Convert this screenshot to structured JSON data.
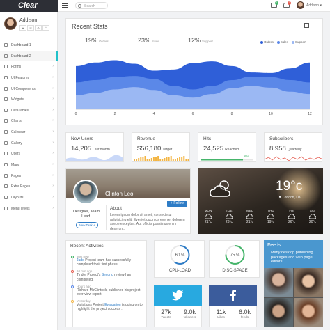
{
  "topbar": {
    "brand": "Clear",
    "search_placeholder": "Search",
    "mail_badge": "1",
    "notif_badge": "2",
    "user_name": "Addison"
  },
  "sidebar": {
    "user_name": "Addison",
    "menu": [
      {
        "label": "Dashboard 1",
        "active": false,
        "has_caret": false
      },
      {
        "label": "Dashboard 2",
        "active": true,
        "has_caret": false
      },
      {
        "label": "Forms",
        "active": false,
        "has_caret": true
      },
      {
        "label": "UI Features",
        "active": false,
        "has_caret": true
      },
      {
        "label": "UI Components",
        "active": false,
        "has_caret": true
      },
      {
        "label": "Widgets",
        "active": false,
        "has_caret": true
      },
      {
        "label": "DataTables",
        "active": false,
        "has_caret": true
      },
      {
        "label": "Charts",
        "active": false,
        "has_caret": true
      },
      {
        "label": "Calendar",
        "active": false,
        "has_caret": true
      },
      {
        "label": "Gallery",
        "active": false,
        "has_caret": true
      },
      {
        "label": "Users",
        "active": false,
        "has_caret": true
      },
      {
        "label": "Maps",
        "active": false,
        "has_caret": true
      },
      {
        "label": "Pages",
        "active": false,
        "has_caret": true
      },
      {
        "label": "Extra Pages",
        "active": false,
        "has_caret": true
      },
      {
        "label": "Layouts",
        "active": false,
        "has_caret": true
      },
      {
        "label": "Menu levels",
        "active": false,
        "has_caret": true
      }
    ]
  },
  "recent_stats": {
    "title": "Recent Stats",
    "kpis": [
      {
        "value": "19%",
        "label": "Orders"
      },
      {
        "value": "23%",
        "label": "Sales"
      },
      {
        "value": "12%",
        "label": "Support"
      }
    ],
    "legend": [
      {
        "label": "Orders",
        "color": "#2f5fd8"
      },
      {
        "label": "Sales",
        "color": "#5b88e8"
      },
      {
        "label": "Support",
        "color": "#9bb8f3"
      }
    ]
  },
  "chart_data": {
    "type": "area",
    "x": [
      0,
      1,
      2,
      3,
      4,
      5,
      6,
      7,
      8,
      9,
      10,
      11,
      12
    ],
    "xticks": [
      "0",
      "2",
      "4",
      "6",
      "8",
      "10",
      "12"
    ],
    "xlim": [
      0,
      12
    ],
    "ylim": [
      0,
      100
    ],
    "series": [
      {
        "name": "Orders",
        "color": "#2f5fd8",
        "values": [
          74,
          80,
          84,
          78,
          66,
          68,
          79,
          82,
          74,
          63,
          62,
          70,
          80
        ]
      },
      {
        "name": "Sales",
        "color": "#5b88e8",
        "values": [
          46,
          50,
          55,
          57,
          52,
          40,
          34,
          40,
          50,
          56,
          55,
          50,
          46
        ]
      },
      {
        "name": "Support",
        "color": "#9bb8f3",
        "values": [
          24,
          28,
          34,
          38,
          33,
          24,
          20,
          26,
          36,
          40,
          37,
          30,
          26
        ]
      }
    ],
    "grid": false
  },
  "small_cards": [
    {
      "title": "New Users",
      "value": "14,205",
      "sub": "Last month",
      "color": "#5b88e8",
      "kind": "area"
    },
    {
      "title": "Revenue",
      "value": "$56,180",
      "sub": "Target",
      "color": "#f3b543",
      "kind": "bars"
    },
    {
      "title": "Hits",
      "value": "24,525",
      "sub": "Reached",
      "color": "#46b56b",
      "kind": "progress",
      "progress_label": "6%"
    },
    {
      "title": "Subscribers",
      "value": "8,958",
      "sub": "Quarterly",
      "color": "#e4594d",
      "kind": "line"
    }
  ],
  "profile": {
    "name": "Clinton Leo",
    "role": "Designer, Team Lead.",
    "task_button": "New Task +",
    "follow_button": "+ Follow",
    "about_title": "About",
    "about_text": "Lorem ipsum dolor sit amet, consectetur adipisicing elit. Eveniet ducimus eveniet dolorem saepe excepturi. Aut officiis possimus enim deserunt."
  },
  "weather": {
    "temperature": "19°c",
    "location": "London, UK",
    "days": [
      {
        "day": "MON",
        "temp": "21°c",
        "icon": "cloud-sun-icon"
      },
      {
        "day": "TUE",
        "temp": "26°c",
        "icon": "cloud-icon"
      },
      {
        "day": "WED",
        "temp": "21°c",
        "icon": "cloud-icon"
      },
      {
        "day": "THU",
        "temp": "19°c",
        "icon": "cloud-icon"
      },
      {
        "day": "FRI",
        "temp": "26°c",
        "icon": "cloud-icon"
      },
      {
        "day": "SAT",
        "temp": "20°c",
        "icon": "cloud-icon"
      }
    ]
  },
  "activities": {
    "title": "Recent Activities",
    "items": [
      {
        "time": "Just now",
        "pre": "",
        "link": "Jade",
        "post": " Project team has successfully completed their first phase.",
        "color": "#46b56b"
      },
      {
        "time": "10 min ago",
        "pre": "Tinder Project's ",
        "link": "Second",
        "post": " review has completed.",
        "color": "#e4594d"
      },
      {
        "time": "Hours ago",
        "pre": "Richard McClintock, published his project over view report.",
        "link": "",
        "post": "",
        "color": "#5b88e8"
      },
      {
        "time": "Yesterday",
        "pre": "Variations Project ",
        "link": "Evaluation",
        "post": " is going on to highlight the project success .",
        "color": "#f3b543"
      }
    ]
  },
  "gauges": [
    {
      "value": 60,
      "label_value": "60 %",
      "label": "CPU-LOAD",
      "color": "#2e7cc6"
    },
    {
      "value": 75,
      "label_value": "75 %",
      "label": "DISC-SPACE",
      "color": "#46b56b"
    }
  ],
  "social": [
    {
      "network": "twitter-icon",
      "color": "#28a9e0",
      "stats": [
        {
          "num": "27k",
          "label": "Tweets"
        },
        {
          "num": "9.0k",
          "label": "followers"
        }
      ]
    },
    {
      "network": "facebook-icon",
      "color": "#3b5c9c",
      "stats": [
        {
          "num": "11k",
          "label": "Likes"
        },
        {
          "num": "6.0k",
          "label": "feeds"
        }
      ]
    }
  ],
  "feeds": {
    "title": "Feeds",
    "text": "Many desktop publishing packages and web page editors."
  }
}
